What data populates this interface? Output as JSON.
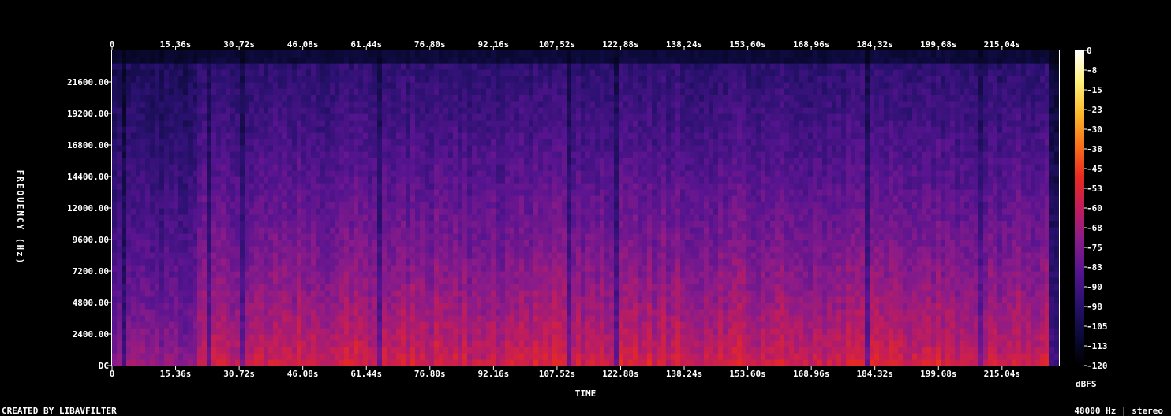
{
  "chart_data": {
    "type": "heatmap",
    "title": "",
    "xlabel": "TIME",
    "ylabel": "FREQUENCY (Hz)",
    "x_ticks": [
      "0",
      "15.36s",
      "30.72s",
      "46.08s",
      "61.44s",
      "76.80s",
      "92.16s",
      "107.52s",
      "122.88s",
      "138.24s",
      "153.60s",
      "168.96s",
      "184.32s",
      "199.68s",
      "215.04s"
    ],
    "x_tick_values": [
      0,
      15.36,
      30.72,
      46.08,
      61.44,
      76.8,
      92.16,
      107.52,
      122.88,
      138.24,
      153.6,
      168.96,
      184.32,
      199.68,
      215.04
    ],
    "xlim": [
      0,
      228.8
    ],
    "y_ticks": [
      "DC",
      "2400.00",
      "4800.00",
      "7200.00",
      "9600.00",
      "12000.00",
      "14400.00",
      "16800.00",
      "19200.00",
      "21600.00"
    ],
    "y_tick_values": [
      0,
      2400,
      4800,
      7200,
      9600,
      12000,
      14400,
      16800,
      19200,
      21600
    ],
    "ylim": [
      0,
      24000
    ],
    "colorbar": {
      "label": "dBFS",
      "ticks": [
        "0",
        "-8",
        "-15",
        "-23",
        "-30",
        "-38",
        "-45",
        "-53",
        "-60",
        "-68",
        "-75",
        "-83",
        "-90",
        "-98",
        "-105",
        "-113",
        "-120"
      ],
      "range": [
        -120,
        0
      ],
      "colormap": [
        "#000000",
        "#0c0a3a",
        "#2a1170",
        "#571490",
        "#8a1b8a",
        "#c21d5b",
        "#ea2a1f",
        "#f9711b",
        "#fdb92b",
        "#fff07a",
        "#ffffff"
      ]
    },
    "grid": false
  },
  "footer": {
    "left": "CREATED BY LIBAVFILTER",
    "right": "48000 Hz | stereo"
  }
}
